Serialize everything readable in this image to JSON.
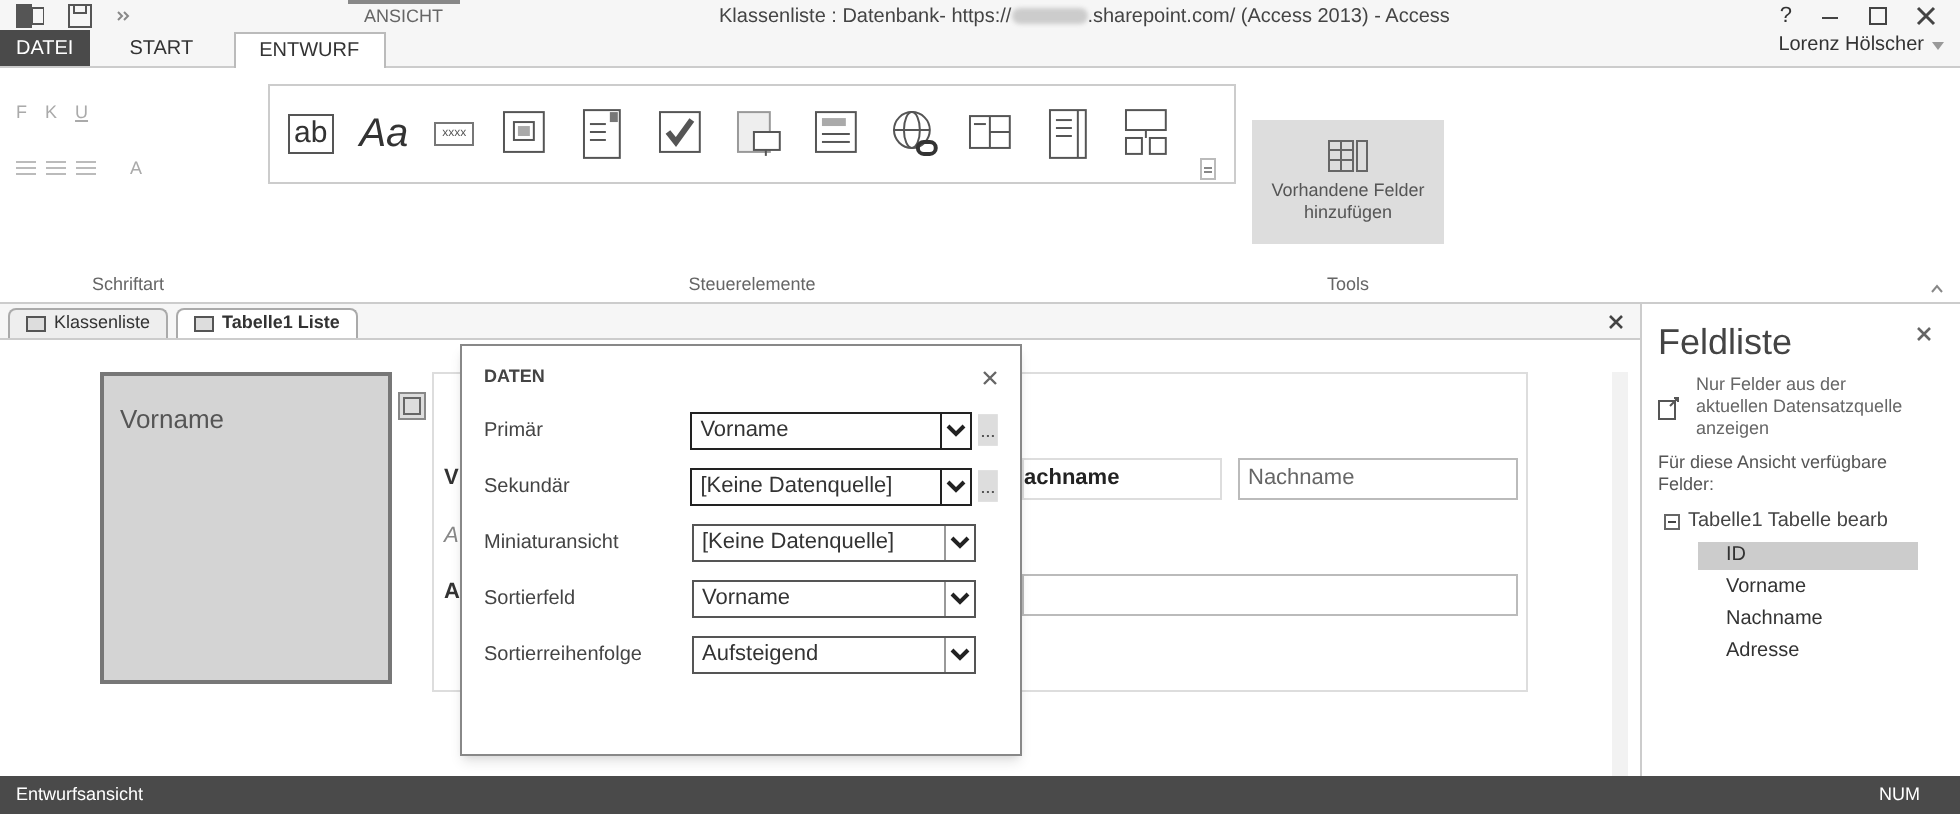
{
  "title_bar": {
    "context_group": "ANSICHT",
    "title_start": "Klassenliste : Datenbank- https://",
    "title_end": ".sharepoint.com/ (Access 2013) - Access",
    "help": "?"
  },
  "ribbon_tabs": [
    {
      "label": "DATEI",
      "kind": "file",
      "selected": false
    },
    {
      "label": "START",
      "kind": "tab",
      "selected": false
    },
    {
      "label": "ENTWURF",
      "kind": "tab",
      "selected": true
    }
  ],
  "user": "Lorenz Hölscher",
  "font_group": {
    "label": "Schriftart",
    "buttons": [
      {
        "label": "F",
        "disabled": true
      },
      {
        "label": "K",
        "disabled": true
      },
      {
        "label": "U",
        "disabled": true
      }
    ],
    "font_color": {
      "label": "A",
      "disabled": true
    }
  },
  "controls_group": {
    "label": "Steuerelemente",
    "items": [
      {
        "kind": "textbox",
        "label": "ab"
      },
      {
        "kind": "label",
        "label": "Aa"
      },
      {
        "kind": "button",
        "label": "xxxx"
      },
      {
        "kind": "image"
      },
      {
        "kind": "combobox"
      },
      {
        "kind": "checkbox"
      },
      {
        "kind": "multivalue"
      },
      {
        "kind": "autocomplete"
      },
      {
        "kind": "hyperlink"
      },
      {
        "kind": "webbrowser"
      },
      {
        "kind": "listbox"
      },
      {
        "kind": "subview"
      }
    ]
  },
  "tools_group": {
    "label": "Tools",
    "button": "Vorhandene Felder hinzufügen",
    "highlighted": true
  },
  "document_tabs": [
    {
      "label": "Klassenliste",
      "selected": false
    },
    {
      "label": "Tabelle1 Liste",
      "selected": true
    }
  ],
  "canvas": {
    "tile_label": "Vorname",
    "behind_popup": {
      "left_label": "V",
      "left_hint": "A",
      "left_button": "A",
      "label": "achname",
      "field": "Nachname"
    }
  },
  "data_popup": {
    "title": "DATEN",
    "rows": [
      {
        "label": "Primär",
        "value": "Vorname",
        "builder": true,
        "active": true
      },
      {
        "label": "Sekundär",
        "value": "[Keine Datenquelle]",
        "builder": true,
        "active": true
      },
      {
        "label": "Miniaturansicht",
        "value": "[Keine Datenquelle]",
        "builder": false,
        "active": false
      },
      {
        "label": "Sortierfeld",
        "value": "Vorname",
        "builder": false,
        "active": false
      },
      {
        "label": "Sortierreihenfolge",
        "value": "Aufsteigend",
        "builder": false,
        "active": false
      }
    ]
  },
  "field_list": {
    "title": "Feldliste",
    "option": "Nur Felder aus der aktuellen Datensatzquelle anzeigen",
    "section": "Für diese Ansicht verfügbare Felder:",
    "tree": [
      {
        "label": "Tabelle1 Tabelle bearb",
        "expanded": true,
        "children": [
          {
            "label": "ID",
            "selected": true
          },
          {
            "label": "Vorname",
            "selected": false
          },
          {
            "label": "Nachname",
            "selected": false
          },
          {
            "label": "Adresse",
            "selected": false
          }
        ]
      }
    ]
  },
  "status_bar": {
    "left": "Entwurfsansicht",
    "right": "NUM"
  }
}
